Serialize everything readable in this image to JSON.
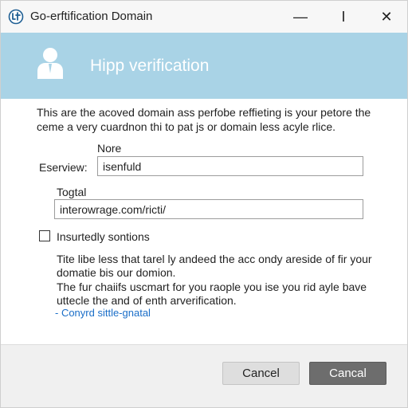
{
  "window": {
    "title": "Go-erftification Domain",
    "controls": {
      "minimize": "—",
      "maximize": "I",
      "close": "✕"
    },
    "app_icon": "globe-badge-icon"
  },
  "banner": {
    "icon": "user-icon",
    "title": "Hipp verification",
    "color": "#a9d3e6"
  },
  "main": {
    "intro_line1": "This are the acoved domain ass perfobe reffieting is your petore the",
    "intro_line2": "ceme a very cuardnon thi to pat js or domain less acyle rlice.",
    "name_label": "Nore",
    "overview_label": "Eserview:",
    "overview_value": "isenfuld",
    "total_label": "Togtal",
    "total_value": "interowrage.com/ricti/",
    "checkbox_label": "Insurtedly sontions",
    "checkbox_checked": false,
    "para1_line1": "Tite libe less that tarel ly andeed the acc ondy areside of fir your",
    "para1_line2": "domatie bis our domion.",
    "para2_line1": "The fur chaiifs uscmart for you raople you ise you rid ayle bave",
    "para2_line2": "uttecle the and of enth arverification.",
    "link_text": "- Conyrd sittle-gnatal",
    "link_color": "#1a6ec8"
  },
  "footer": {
    "secondary_button": "Cancel",
    "primary_button": "Cancal",
    "primary_color": "#6d6d6d"
  }
}
